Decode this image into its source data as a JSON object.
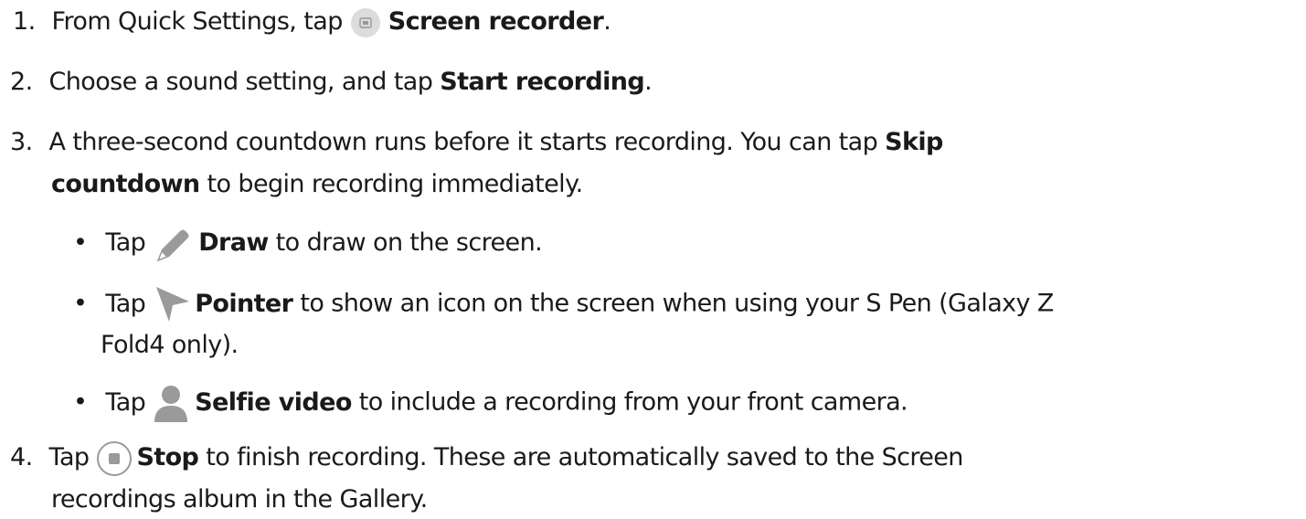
{
  "steps": [
    {
      "number": "1.",
      "lines": [
        {
          "pre": "From Quick Settings, tap ",
          "bold": "Screen recorder",
          "post": "."
        }
      ],
      "icon": "screen-recorder-icon"
    },
    {
      "number": "2.",
      "lines": [
        {
          "pre": "Choose a sound setting, and tap ",
          "bold": "Start recording",
          "post": "."
        }
      ]
    },
    {
      "number": "3.",
      "line1": {
        "pre": "A three-second countdown runs before it starts recording. You can tap ",
        "bold": "Skip"
      },
      "line2": {
        "bold": "countdown",
        "post": " to begin recording immediately."
      }
    },
    {
      "number": "4.",
      "line1": {
        "pre": "Tap ",
        "bold": "Stop",
        "post": " to finish recording. These are automatically saved to the Screen"
      },
      "line2": {
        "text": "recordings album in the Gallery."
      },
      "icon": "stop-icon"
    }
  ],
  "bullets": [
    {
      "pre": "Tap ",
      "bold": "Draw",
      "post": " to draw on the screen.",
      "icon": "draw-icon"
    },
    {
      "pre": "Tap ",
      "bold": "Pointer",
      "post": " to show an icon on the screen when using your S Pen (Galaxy Z",
      "line2": "Fold4 only).",
      "icon": "pointer-icon"
    },
    {
      "pre": "Tap ",
      "bold": "Selfie video",
      "post": " to include a recording from your front camera.",
      "icon": "selfie-icon"
    }
  ],
  "bullet_symbol": "•",
  "colors": {
    "text": "#1a1a1a",
    "icon_gray": "#9a9a9a",
    "icon_bg": "#dcdcdc"
  }
}
